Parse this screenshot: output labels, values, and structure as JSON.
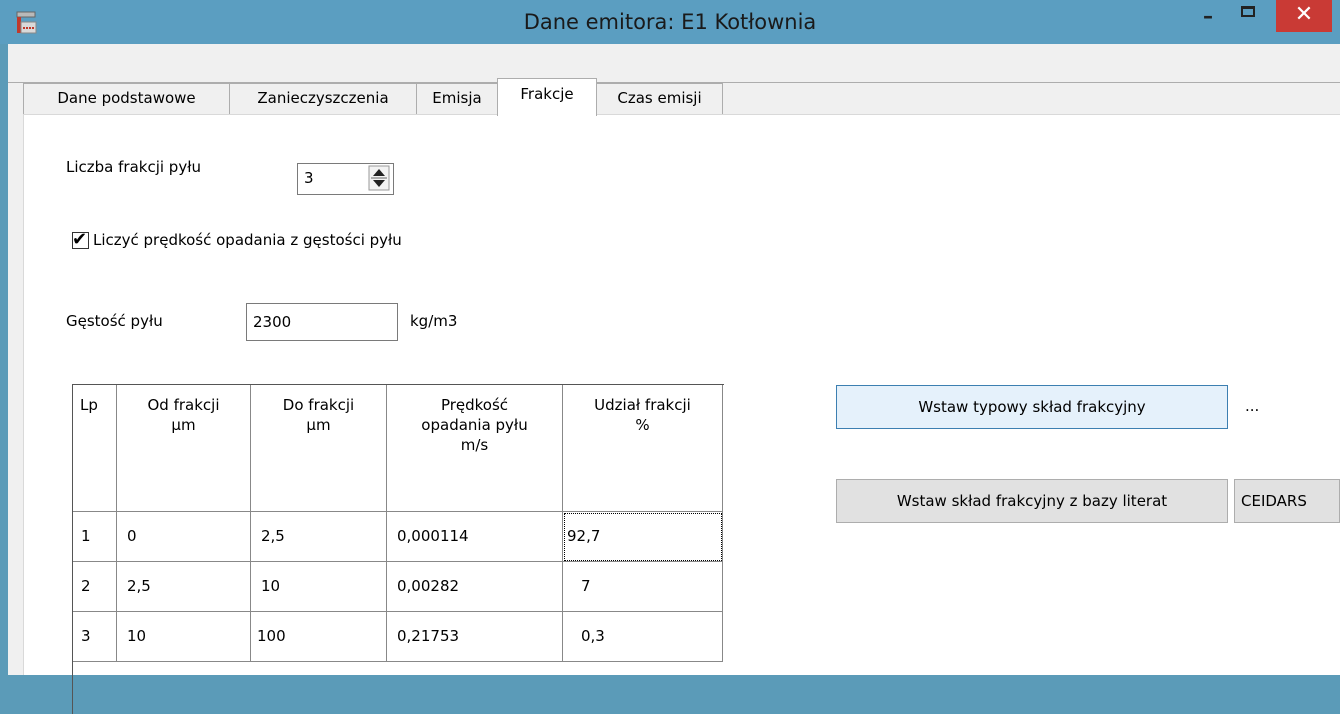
{
  "window": {
    "title": "Dane emitora: E1 Kotłownia",
    "minimize_glyph": "–",
    "close_glyph": "✕",
    "accent": "#5b9ec1",
    "close_color": "#c93a35"
  },
  "tabs": [
    {
      "label": "Dane podstawowe",
      "active": false
    },
    {
      "label": "Zanieczyszczenia",
      "active": false
    },
    {
      "label": "Emisja",
      "active": false
    },
    {
      "label": "Frakcje",
      "active": true
    },
    {
      "label": "Czas emisji",
      "active": false
    }
  ],
  "form": {
    "fraction_count_label": "Liczba frakcji pyłu",
    "fraction_count_value": "3",
    "checkbox_label": "Liczyć prędkość opadania z gęstości pyłu",
    "checkbox_checked": true,
    "density_label": "Gęstość pyłu",
    "density_value": "2300",
    "density_unit": "kg/m3"
  },
  "table": {
    "headers": [
      "Lp",
      "Od frakcji\nµm",
      "Do frakcji\nµm",
      "Prędkość\nopadania pyłu\nm/s",
      "Udział frakcji\n%"
    ],
    "rows": [
      [
        "1",
        "0",
        "2,5",
        "0,000114",
        "92,7"
      ],
      [
        "2",
        "2,5",
        "10",
        "0,00282",
        "7"
      ],
      [
        "3",
        "10",
        "100",
        "0,21753",
        "0,3"
      ]
    ]
  },
  "buttons": {
    "insert_typical": "Wstaw typowy skład frakcyjny",
    "more": "...",
    "insert_from_literature": "Wstaw skład frakcyjny z bazy literat",
    "ceidars": "CEIDARS"
  }
}
